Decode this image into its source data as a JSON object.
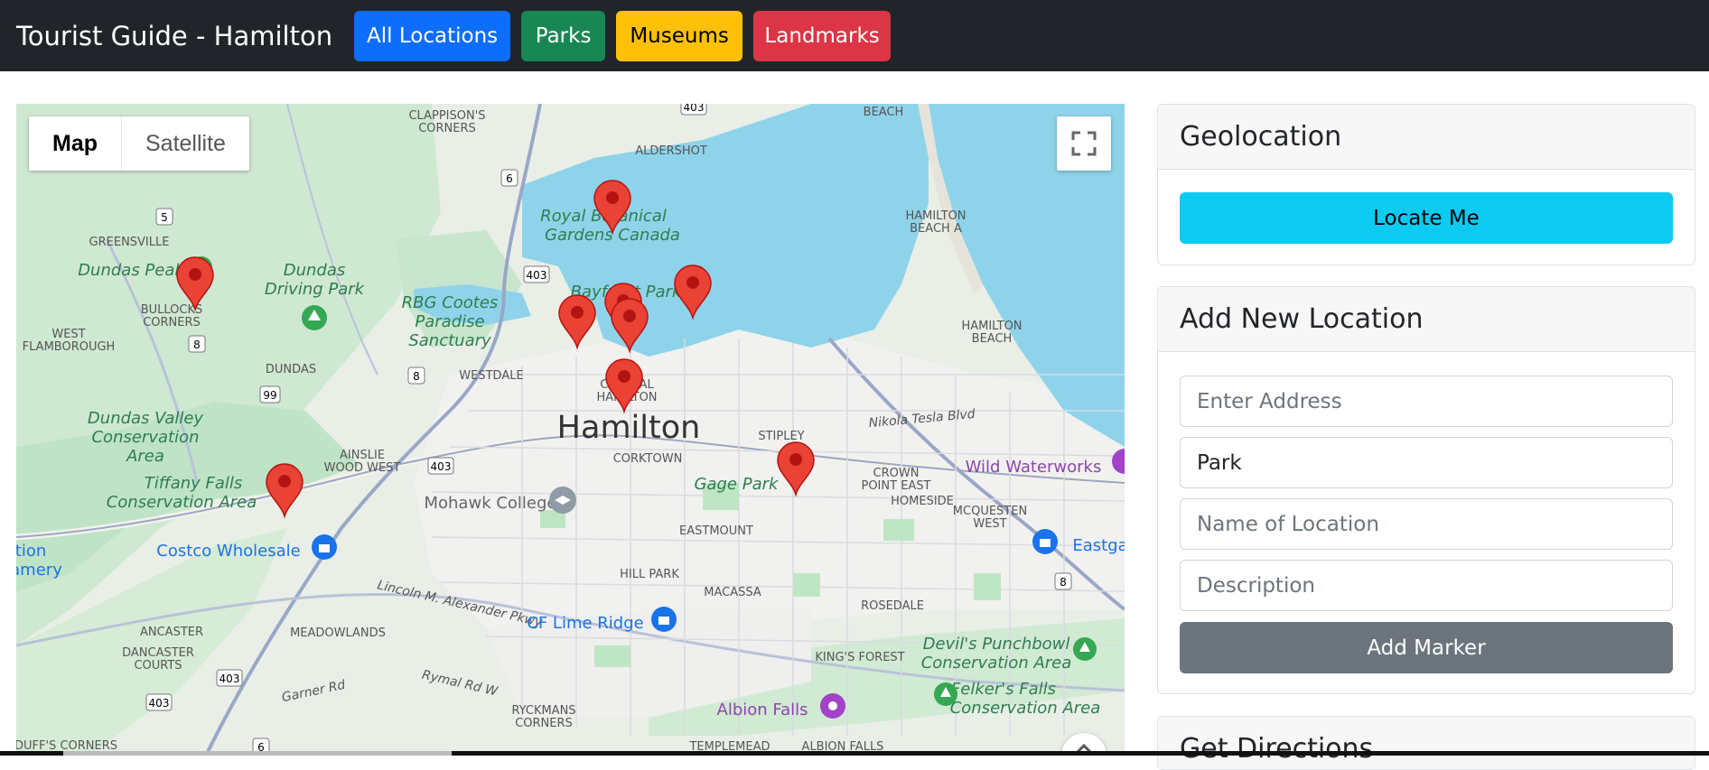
{
  "navbar": {
    "brand": "Tourist Guide - Hamilton",
    "buttons": {
      "all": "All Locations",
      "parks": "Parks",
      "museums": "Museums",
      "landmarks": "Landmarks"
    }
  },
  "map": {
    "type_control": {
      "map": "Map",
      "satellite": "Satellite"
    },
    "labels": {
      "clappisons": "CLAPPISON'S",
      "corners1": "CORNERS",
      "beach": "BEACH",
      "aldershot": "ALDERSHOT",
      "royal1": "Royal Botanical",
      "royal2": "Gardens Canada",
      "hamilton_beach_a1": "HAMILTON",
      "hamilton_beach_a2": "BEACH A",
      "greensville": "GREENSVILLE",
      "dundas_peak": "Dundas Peak",
      "dundas_driving1": "Dundas",
      "dundas_driving2": "Driving Park",
      "rbg1": "RBG Cootes",
      "rbg2": "Paradise",
      "rbg3": "Sanctuary",
      "bayfront": "Bayfront Park",
      "hamilton_beach1": "HAMILTON",
      "hamilton_beach2": "BEACH",
      "bullocks1": "BULLOCKS",
      "bullocks2": "CORNERS",
      "west1": "WEST",
      "west2": "FLAMBOROUGH",
      "dundas": "DUNDAS",
      "westdale": "WESTDALE",
      "central1": "CENTRAL",
      "central2": "HAMILTON",
      "hamilton": "Hamilton",
      "stipley": "STIPLEY",
      "nikola": "Nikola Tesla Blvd",
      "dundas_valley1": "Dundas Valley",
      "dundas_valley2": "Conservation",
      "dundas_valley3": "Area",
      "ainslie1": "AINSLIE",
      "ainslie2": "WOOD WEST",
      "corktown": "CORKTOWN",
      "gage_park": "Gage Park",
      "crown1": "CROWN",
      "crown2": "POINT EAST",
      "homeside": "HOMESIDE",
      "wild_waterworks": "Wild Waterworks",
      "tiffany1": "Tiffany Falls",
      "tiffany2": "Conservation Area",
      "mohawk": "Mohawk College",
      "mcquesten1": "MCQUESTEN",
      "mcquesten2": "WEST",
      "eastmount": "EASTMOUNT",
      "eastgate": "Eastga",
      "tion": "tion",
      "amery": "amery",
      "costco": "Costco Wholesale",
      "lincoln": "Lincoln M. Alexander Pkwy",
      "hill_park": "HILL PARK",
      "macassa": "MACASSA",
      "rosedale": "ROSEDALE",
      "cf_lime": "CF Lime Ridge",
      "ancaster": "ANCASTER",
      "meadowlands": "MEADOWLANDS",
      "dancaster1": "DANCASTER",
      "dancaster2": "COURTS",
      "devils1": "Devil's Punchbowl",
      "devils2": "Conservation Area",
      "kings_forest": "KING'S FOREST",
      "felkers1": "Felker's Falls",
      "felkers2": "Conservation Area",
      "garner": "Garner Rd",
      "rymal": "Rymal Rd W",
      "albion": "Albion Falls",
      "ryckmans1": "RYCKMANS",
      "ryckmans2": "CORNERS",
      "duffs": "DUFF'S CORNERS",
      "templemead": "TEMPLEMEAD",
      "albion_falls_area": "ALBION FALLS"
    },
    "shields": {
      "h403a": "403",
      "h6a": "6",
      "h5": "5",
      "h403b": "403",
      "h8a": "8",
      "h99": "99",
      "h8b": "8",
      "h403c": "403",
      "h8c": "8",
      "h403d": "403",
      "h403e": "403",
      "h6b": "6"
    }
  },
  "geolocation": {
    "title": "Geolocation",
    "locate_label": "Locate Me"
  },
  "add_location": {
    "title": "Add New Location",
    "address_placeholder": "Enter Address",
    "category_value": "Park",
    "name_placeholder": "Name of Location",
    "description_placeholder": "Description",
    "add_label": "Add Marker"
  },
  "directions": {
    "title": "Get Directions"
  },
  "colors": {
    "navbar": "#212529",
    "primary": "#0d6efd",
    "success": "#198754",
    "warning": "#ffc107",
    "danger": "#dc3545",
    "info": "#0dcaf0",
    "secondary": "#6c757d",
    "water": "#8fd3ea",
    "park": "#cdebd3",
    "marker": "#ea4335"
  }
}
